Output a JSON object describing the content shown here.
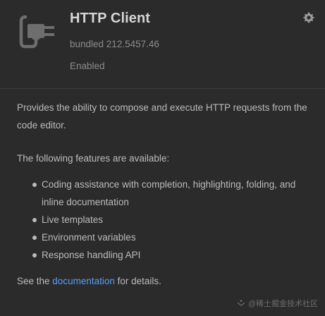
{
  "plugin": {
    "icon": "plug-icon",
    "name": "HTTP Client",
    "version": "bundled 212.5457.46",
    "status": "Enabled",
    "settings_icon": "gear-icon"
  },
  "description": {
    "summary": "Provides the ability to compose and execute HTTP requests from the code editor.",
    "features_intro": "The following features are available:",
    "features": [
      "Coding assistance with completion, highlighting, folding, and inline documentation",
      "Live templates",
      "Environment variables",
      "Response handling API"
    ],
    "footer_prefix": "See the ",
    "footer_link": "documentation",
    "footer_suffix": " for details."
  },
  "watermark": {
    "text": "@稀土掘金技术社区"
  },
  "colors": {
    "background": "#2b2b2b",
    "text": "#bbbbbb",
    "link": "#589df6",
    "muted": "#8c8c8c"
  }
}
